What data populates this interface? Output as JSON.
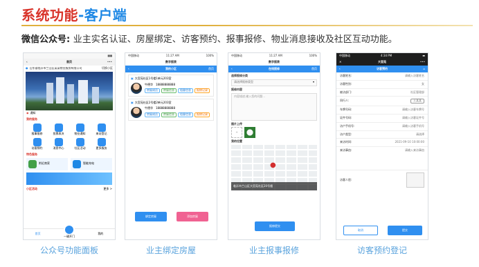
{
  "title_a": "系统功能",
  "title_b": "-客户端",
  "subtitle_lead": "微信公众号:",
  "subtitle_desc": "业主实名认证、房屋绑定、访客预约、报事报修、物业消息接收及社区互动功能。",
  "captions": [
    "公众号功能面板",
    "业主绑定房屋",
    "业主报事报修",
    "访客预约登记"
  ],
  "p1": {
    "status_left": "",
    "nav_title": "首页",
    "location": "山东省临沂市兰山区某某物业服务有限公司",
    "community": "切换小区",
    "notice": "通知",
    "services_title": "我的服务",
    "services": [
      "报事报修",
      "投票表决",
      "物业通知",
      "来访登记",
      "访客预约",
      "消息中心",
      "社区活动",
      "更多服务"
    ],
    "feature_title": "特色服务",
    "feature_a": "附近商家",
    "feature_b": "智能充电",
    "banner_text": "",
    "activity_title": "小区活动",
    "activity_more": "更多 >",
    "tabs": [
      "首页",
      "一键开门",
      "我的"
    ]
  },
  "p2": {
    "carrier": "中国移动",
    "time": "11:27 AM",
    "battery": "100%",
    "app_title": "数字报表",
    "nav_title": "我的小区",
    "nav_right": "首页",
    "houses": [
      {
        "addr": "大官苑社区1号楼1单元203室",
        "name": "牛德华",
        "phone": "18888888888",
        "tags": [
          "房屋成员",
          "房屋信息",
          "租客信息",
          "报修记录"
        ]
      },
      {
        "addr": "大官苑社区2号楼2单元203室",
        "name": "牛德华",
        "phone": "18888888888",
        "tags": [
          "房屋成员",
          "房屋信息",
          "租客信息",
          "报修记录"
        ]
      }
    ],
    "btn_bind": "绑定房屋",
    "btn_add": "添加房屋"
  },
  "p3": {
    "carrier": "中国移动",
    "time": "11:27 AM",
    "battery": "100%",
    "app_title": "数字报表",
    "nav_title": "在线报修",
    "nav_right": "首页",
    "type_label": "选择报修分类",
    "type_placeholder": "请选择报修类型",
    "content_label": "报修内容",
    "content_placeholder": "内容描述,输入您的问题...",
    "photo_label": "图片上传",
    "location_label": "我的位置",
    "address": "临沂市兰山区大官苑社区20号楼",
    "submit": "报修提交"
  },
  "p4": {
    "carrier": "中国移动",
    "time": "4:34 PM",
    "battery": "",
    "app_title": "大官苑",
    "nav_title": "访客预约",
    "fields": [
      {
        "k": "访客姓名:",
        "v": "请输入访客姓名"
      },
      {
        "k": "访客性别:",
        "v": "女"
      },
      {
        "k": "被访部门:",
        "v": "社区管理部"
      },
      {
        "k": "同行人:",
        "v": "王某某"
      },
      {
        "k": "车牌号码:",
        "v": "请输入访客车牌号"
      },
      {
        "k": "证件号码:",
        "v": "请输入访客证件号"
      },
      {
        "k": "访户手机号:",
        "v": "请输入访客手机号"
      },
      {
        "k": "访户类型:",
        "v": "请选择"
      },
      {
        "k": "来访时间:",
        "v": "2021-09-10  10:00:00"
      },
      {
        "k": "来访事由:",
        "v": "请输入来访事由"
      }
    ],
    "photo_label": "访客人脸:",
    "cancel": "取消",
    "submit": "提交"
  }
}
